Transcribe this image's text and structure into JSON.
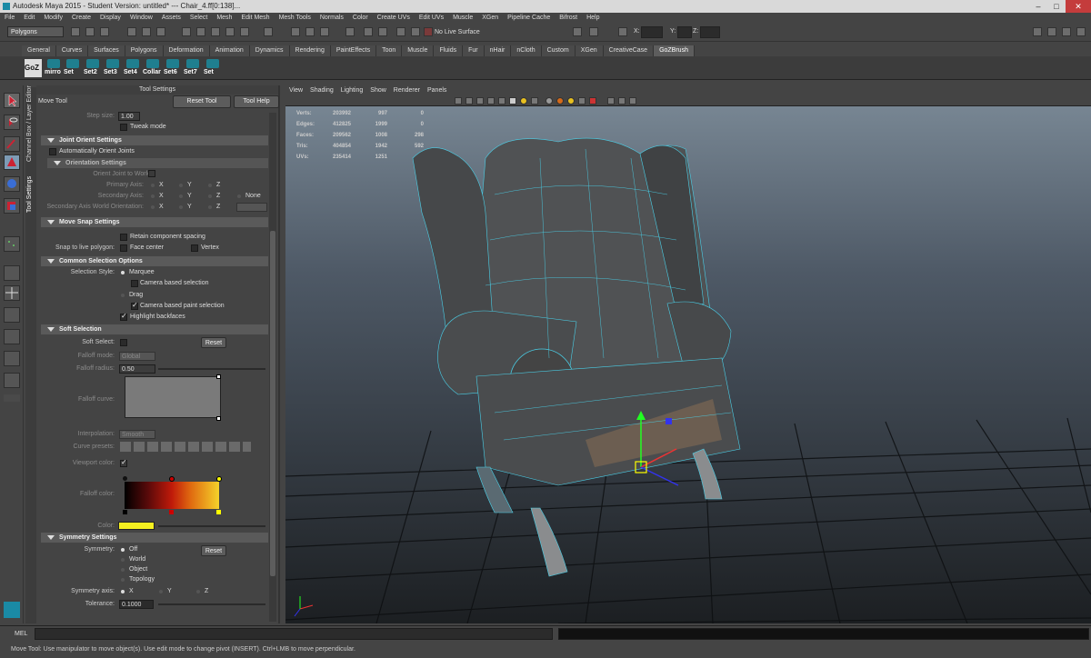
{
  "window": {
    "title": "Autodesk Maya 2015 - Student Version: untitled*   ---   Chair_4.ff[0:138]...",
    "minimize": "–",
    "maximize": "□",
    "close": "✕"
  },
  "menubar": [
    "File",
    "Edit",
    "Modify",
    "Create",
    "Display",
    "Window",
    "Assets",
    "Select",
    "Mesh",
    "Edit Mesh",
    "Mesh Tools",
    "Normals",
    "Color",
    "Create UVs",
    "Edit UVs",
    "Muscle",
    "XGen",
    "Pipeline Cache",
    "Bifrost",
    "Help"
  ],
  "statusline": {
    "mode": "Polygons",
    "live_surface": "No Live Surface",
    "x_label": "X:",
    "y_label": "Y:",
    "z_label": "Z:"
  },
  "shelf_tabs": [
    "General",
    "Curves",
    "Surfaces",
    "Polygons",
    "Deformation",
    "Animation",
    "Dynamics",
    "Rendering",
    "PaintEffects",
    "Toon",
    "Muscle",
    "Fluids",
    "Fur",
    "nHair",
    "nCloth",
    "Custom",
    "XGen",
    "CreativeCase",
    "GoZBrush"
  ],
  "shelf_active_tab": "GoZBrush",
  "shelf_buttons": [
    "GoZ",
    "mirro",
    "Set",
    "Set2",
    "Set3",
    "Set4",
    "Collar",
    "Set6",
    "Set7",
    "Set"
  ],
  "side_tabs": {
    "channel": "Channel Box / Layer Editor",
    "tool": "Tool Settings"
  },
  "tool_settings": {
    "header": "Tool Settings",
    "tool_name": "Move Tool",
    "reset_tool": "Reset Tool",
    "tool_help": "Tool Help",
    "step_size_label": "Step size:",
    "step_size_value": "1.00",
    "tweak_mode": "Tweak mode",
    "joint_orient": "Joint Orient Settings",
    "auto_orient": "Automatically Orient Joints",
    "orientation_settings": "Orientation Settings",
    "orient_world": "Orient Joint to World:",
    "primary_axis": "Primary Axis:",
    "secondary_axis": "Secondary Axis:",
    "secondary_world": "Secondary Axis World Orientation:",
    "axis_x": "X",
    "axis_y": "Y",
    "axis_z": "Z",
    "axis_none": "None",
    "move_snap": "Move Snap Settings",
    "retain_spacing": "Retain component spacing",
    "snap_live": "Snap to live polygon:",
    "face_center": "Face center",
    "vertex": "Vertex",
    "common_selection": "Common Selection Options",
    "selection_style": "Selection Style:",
    "marquee": "Marquee",
    "camera_based": "Camera based selection",
    "drag": "Drag",
    "camera_paint": "Camera based paint selection",
    "highlight_backfaces": "Highlight backfaces",
    "soft_selection": "Soft Selection",
    "soft_select": "Soft Select:",
    "reset": "Reset",
    "falloff_mode": "Falloff mode:",
    "falloff_mode_value": "Global",
    "falloff_radius": "Falloff radius:",
    "falloff_radius_value": "0.50",
    "falloff_curve": "Falloff curve:",
    "interpolation": "Interpolation:",
    "interpolation_value": "Smooth",
    "curve_presets": "Curve presets:",
    "viewport_color": "Viewport color:",
    "falloff_color": "Falloff color:",
    "color": "Color:",
    "symmetry_settings": "Symmetry Settings",
    "symmetry": "Symmetry:",
    "sym_off": "Off",
    "sym_world": "World",
    "sym_object": "Object",
    "sym_topology": "Topology",
    "symmetry_axis": "Symmetry axis:",
    "tolerance": "Tolerance:",
    "tolerance_value": "0.1000"
  },
  "viewport": {
    "menu": [
      "View",
      "Shading",
      "Lighting",
      "Show",
      "Renderer",
      "Panels"
    ],
    "hud_rows": [
      {
        "label": "Verts:",
        "a": "203992",
        "b": "997",
        "c": "0"
      },
      {
        "label": "Edges:",
        "a": "412825",
        "b": "1999",
        "c": "0"
      },
      {
        "label": "Faces:",
        "a": "209562",
        "b": "1008",
        "c": "298"
      },
      {
        "label": "Tris:",
        "a": "404854",
        "b": "1942",
        "c": "592"
      },
      {
        "label": "UVs:",
        "a": "235414",
        "b": "1251",
        "c": "0"
      }
    ]
  },
  "commandline": {
    "label": "MEL"
  },
  "helpline": "Move Tool: Use manipulator to move object(s). Use edit mode to change pivot (INSERT).  Ctrl+LMB to move perpendicular."
}
